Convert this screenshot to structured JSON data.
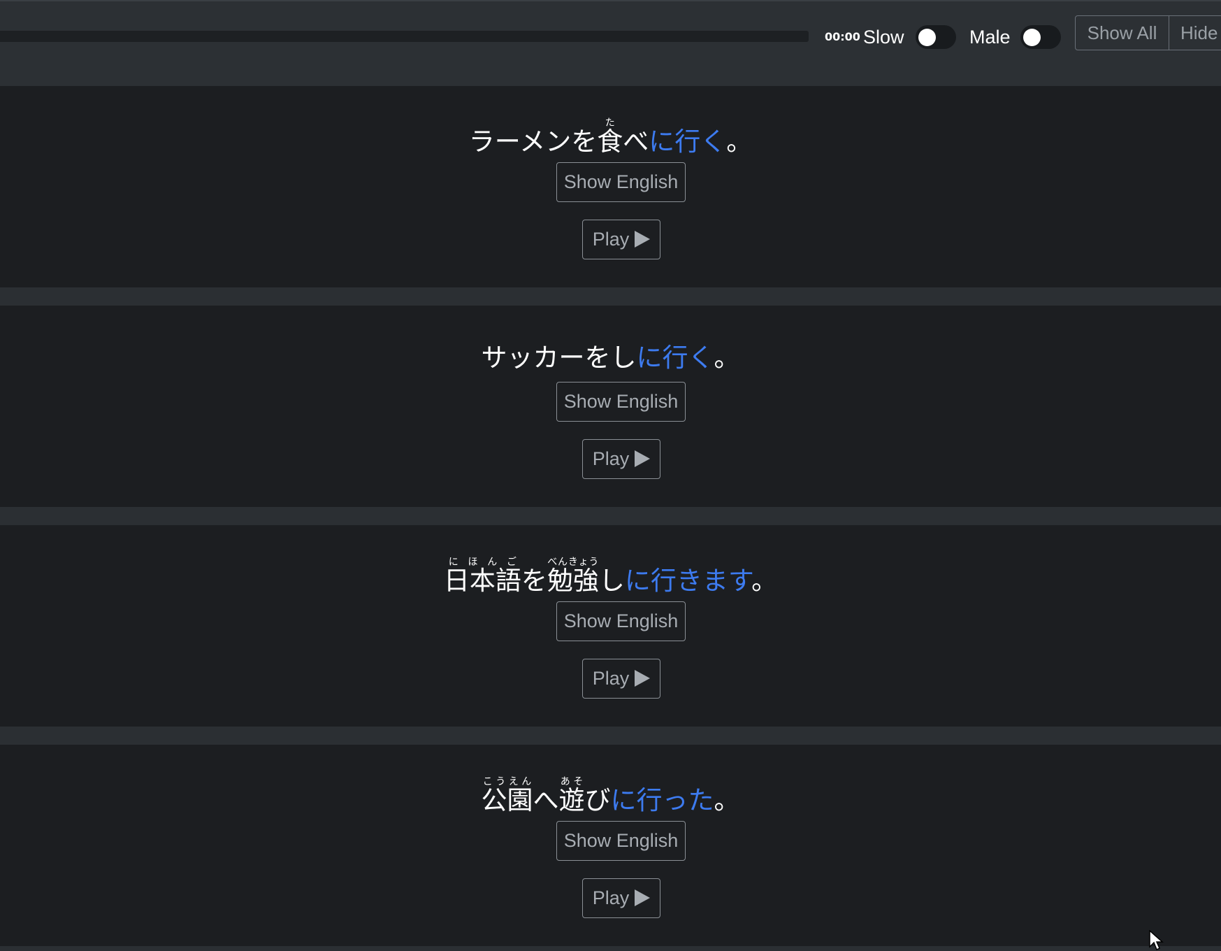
{
  "player": {
    "time": "00:00",
    "progress_fraction": 0,
    "slow_label": "Slow",
    "slow_on": false,
    "male_label": "Male",
    "male_on": false,
    "show_all_label": "Show All",
    "hide_label": "Hide"
  },
  "colors": {
    "highlight": "#3d7bf0",
    "card_bg": "#1c1e21",
    "page_bg": "#2b2f33"
  },
  "sentences": [
    {
      "parts": [
        {
          "text": "ラーメンを"
        },
        {
          "text": "食",
          "ruby": "た"
        },
        {
          "text": "べ"
        },
        {
          "text": "に行く",
          "highlight": true
        },
        {
          "text": "。"
        }
      ],
      "show_english_label": "Show English",
      "play_label": "Play"
    },
    {
      "parts": [
        {
          "text": "サッカーをし"
        },
        {
          "text": "に行く",
          "highlight": true
        },
        {
          "text": "。"
        }
      ],
      "show_english_label": "Show English",
      "play_label": "Play"
    },
    {
      "parts": [
        {
          "text": "日本語",
          "ruby": "にほんご"
        },
        {
          "text": "を"
        },
        {
          "text": "勉強",
          "ruby": "べんきょう"
        },
        {
          "text": "し"
        },
        {
          "text": "に行きます",
          "highlight": true
        },
        {
          "text": "。"
        }
      ],
      "show_english_label": "Show English",
      "play_label": "Play"
    },
    {
      "parts": [
        {
          "text": "公園",
          "ruby": "こうえん"
        },
        {
          "text": "へ"
        },
        {
          "text": "遊",
          "ruby": "あそ"
        },
        {
          "text": "び"
        },
        {
          "text": "に行った",
          "highlight": true
        },
        {
          "text": "。"
        }
      ],
      "show_english_label": "Show English",
      "play_label": "Play"
    }
  ]
}
